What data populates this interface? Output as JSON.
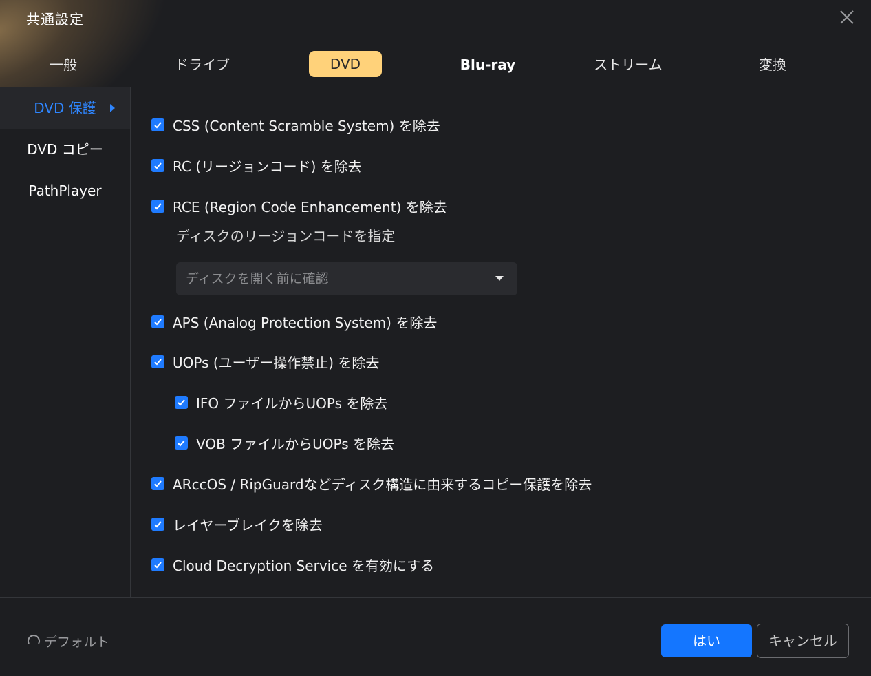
{
  "window": {
    "title": "共通設定"
  },
  "tabs": [
    {
      "label": "一般"
    },
    {
      "label": "ドライブ"
    },
    {
      "label": "DVD"
    },
    {
      "label": "Blu-ray"
    },
    {
      "label": "ストリーム"
    },
    {
      "label": "変換"
    }
  ],
  "sidebar": {
    "items": [
      {
        "label": "DVD 保護"
      },
      {
        "label": "DVD コピー"
      },
      {
        "label": "PathPlayer"
      }
    ]
  },
  "options": [
    {
      "label": "CSS (Content Scramble System) を除去",
      "checked": true
    },
    {
      "label": "RC (リージョンコード) を除去",
      "checked": true
    },
    {
      "label": "RCE (Region Code Enhancement) を除去",
      "checked": true
    },
    {
      "label": "APS (Analog Protection System) を除去",
      "checked": true
    },
    {
      "label": "UOPs (ユーザー操作禁止) を除去",
      "checked": true
    },
    {
      "label": "IFO ファイルからUOPs を除去",
      "checked": true
    },
    {
      "label": "VOB ファイルからUOPs を除去",
      "checked": true
    },
    {
      "label": "ARccOS / RipGuardなどディスク構造に由来するコピー保護を除去",
      "checked": true
    },
    {
      "label": "レイヤーブレイクを除去",
      "checked": true
    },
    {
      "label": "Cloud Decryption Service を有効にする",
      "checked": true
    }
  ],
  "region": {
    "label": "ディスクのリージョンコードを指定",
    "selected": "ディスクを開く前に確認"
  },
  "footer": {
    "default_label": "デフォルト",
    "ok_label": "はい",
    "cancel_label": "キャンセル"
  },
  "colors": {
    "accent": "#1476ff",
    "active_tab": "#ffd27a",
    "sidebar_active_text": "#2f86ff"
  }
}
